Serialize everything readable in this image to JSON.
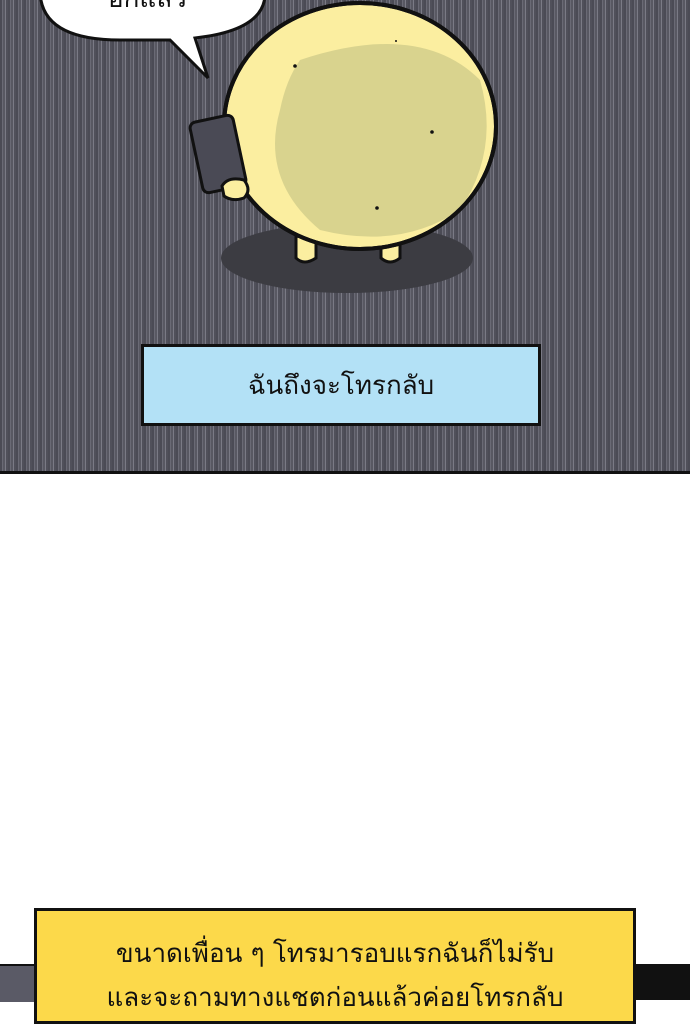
{
  "speech_bubble": {
    "text": "อีกแล้ว"
  },
  "top_caption": {
    "text": "ฉันถึงจะโทรกลับ"
  },
  "bottom_caption": {
    "line1": "ขนาดเพื่อน ๆ โทรมารอบแรกฉันก็ไม่รับ",
    "line2": "และจะถามทางแชตก่อนแล้วค่อยโทรกลับ"
  },
  "colors": {
    "panel_bg": "#55555f",
    "character_body": "#fbeea0",
    "character_shade": "#d9d38e",
    "phone": "#4a4a55",
    "caption_blue": "#b3e1f6",
    "caption_yellow": "#fcd94a"
  }
}
